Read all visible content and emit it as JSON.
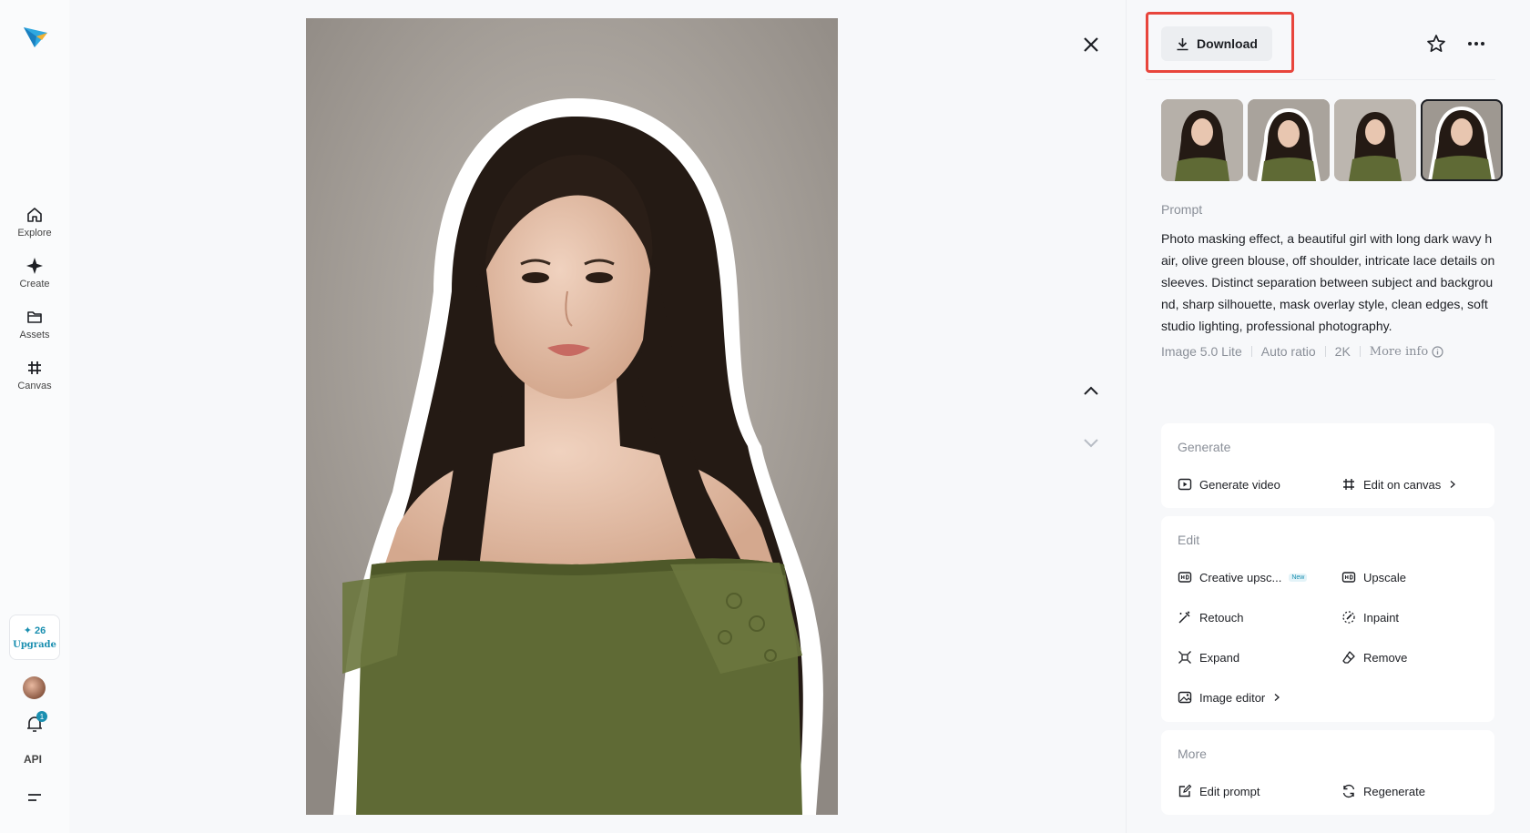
{
  "nav": {
    "items": [
      {
        "label": "Explore",
        "icon": "home-icon"
      },
      {
        "label": "Create",
        "icon": "sparkle-icon"
      },
      {
        "label": "Assets",
        "icon": "folder-icon"
      },
      {
        "label": "Canvas",
        "icon": "canvas-icon"
      }
    ],
    "credits": "✦ 26",
    "upgrade_label": "Upgrade",
    "notification_count": "1",
    "api_label": "API"
  },
  "toolbar": {
    "download_label": "Download"
  },
  "prompt": {
    "label": "Prompt",
    "text": "Photo masking effect, a beautiful girl with long dark wavy hair, olive green blouse, off shoulder, intricate lace details on sleeves. Distinct separation between subject and background, sharp silhouette, mask overlay style, clean edges, soft studio lighting, professional photography."
  },
  "meta": {
    "model": "Image 5.0 Lite",
    "ratio": "Auto ratio",
    "resolution": "2K",
    "more_info": "More info"
  },
  "generate": {
    "title": "Generate",
    "generate_video": "Generate video",
    "edit_on_canvas": "Edit on canvas"
  },
  "edit": {
    "title": "Edit",
    "creative_upscale": "Creative upsc...",
    "new_badge": "New",
    "upscale": "Upscale",
    "retouch": "Retouch",
    "inpaint": "Inpaint",
    "expand": "Expand",
    "remove": "Remove",
    "image_editor": "Image editor"
  },
  "more": {
    "title": "More",
    "edit_prompt": "Edit prompt",
    "regenerate": "Regenerate"
  },
  "colors": {
    "accent": "#1a8fb0",
    "highlight": "#e8453c",
    "blouse": "#5f6a35",
    "hair": "#241a14"
  }
}
